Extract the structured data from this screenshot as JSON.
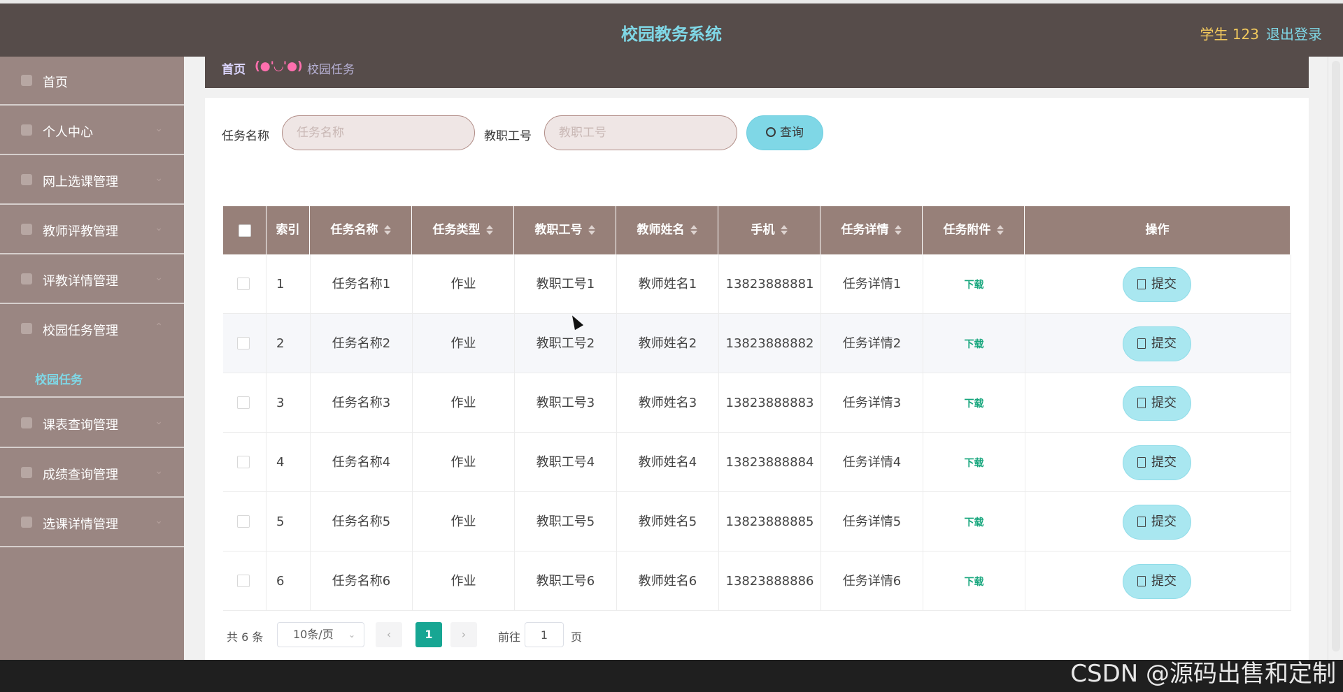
{
  "header": {
    "app_title": "校园教务系统",
    "user_label": "学生 123",
    "logout_label": "退出登录"
  },
  "sidebar": {
    "items": [
      {
        "label": "首页",
        "icon": "home-icon"
      },
      {
        "label": "个人中心",
        "icon": "user-icon"
      },
      {
        "label": "网上选课管理",
        "icon": "user-icon"
      },
      {
        "label": "教师评教管理",
        "icon": "monitor-icon"
      },
      {
        "label": "评教详情管理",
        "icon": "image-icon"
      },
      {
        "label": "校园任务管理",
        "icon": "user-icon"
      },
      {
        "label": "课表查询管理",
        "icon": "crop-icon"
      },
      {
        "label": "成绩查询管理",
        "icon": "doc-icon"
      },
      {
        "label": "选课详情管理",
        "icon": "image-icon"
      }
    ],
    "active_submenu": "校园任务"
  },
  "breadcrumb": {
    "home": "首页",
    "separator": "(●'◡'●)",
    "current": "校园任务"
  },
  "search": {
    "task_name_label": "任务名称",
    "task_name_placeholder": "任务名称",
    "staff_no_label": "教职工号",
    "staff_no_placeholder": "教职工号",
    "query_label": "查询"
  },
  "table": {
    "columns": [
      "索引",
      "任务名称",
      "任务类型",
      "教职工号",
      "教师姓名",
      "手机",
      "任务详情",
      "任务附件",
      "操作"
    ],
    "rows": [
      {
        "index": "1",
        "name": "任务名称1",
        "type": "作业",
        "staff_no": "教职工号1",
        "teacher": "教师姓名1",
        "phone": "13823888881",
        "detail": "任务详情1",
        "attachment": "下载",
        "action": "提交"
      },
      {
        "index": "2",
        "name": "任务名称2",
        "type": "作业",
        "staff_no": "教职工号2",
        "teacher": "教师姓名2",
        "phone": "13823888882",
        "detail": "任务详情2",
        "attachment": "下载",
        "action": "提交"
      },
      {
        "index": "3",
        "name": "任务名称3",
        "type": "作业",
        "staff_no": "教职工号3",
        "teacher": "教师姓名3",
        "phone": "13823888883",
        "detail": "任务详情3",
        "attachment": "下载",
        "action": "提交"
      },
      {
        "index": "4",
        "name": "任务名称4",
        "type": "作业",
        "staff_no": "教职工号4",
        "teacher": "教师姓名4",
        "phone": "13823888884",
        "detail": "任务详情4",
        "attachment": "下载",
        "action": "提交"
      },
      {
        "index": "5",
        "name": "任务名称5",
        "type": "作业",
        "staff_no": "教职工号5",
        "teacher": "教师姓名5",
        "phone": "13823888885",
        "detail": "任务详情5",
        "attachment": "下载",
        "action": "提交"
      },
      {
        "index": "6",
        "name": "任务名称6",
        "type": "作业",
        "staff_no": "教职工号6",
        "teacher": "教师姓名6",
        "phone": "13823888886",
        "detail": "任务详情6",
        "attachment": "下载",
        "action": "提交"
      }
    ]
  },
  "pagination": {
    "total_label": "共 6 条",
    "page_size": "10条/页",
    "prev": "‹",
    "current_page": "1",
    "next": "›",
    "goto_label": "前往",
    "goto_value": "1",
    "page_suffix": "页"
  },
  "watermark": "CSDN @源码出售和定制",
  "colors": {
    "header_bg": "#564c4a",
    "sidebar_bg": "#9a8682",
    "accent": "#7fd7e6",
    "table_header_bg": "#978079",
    "active_page": "#17a693"
  }
}
